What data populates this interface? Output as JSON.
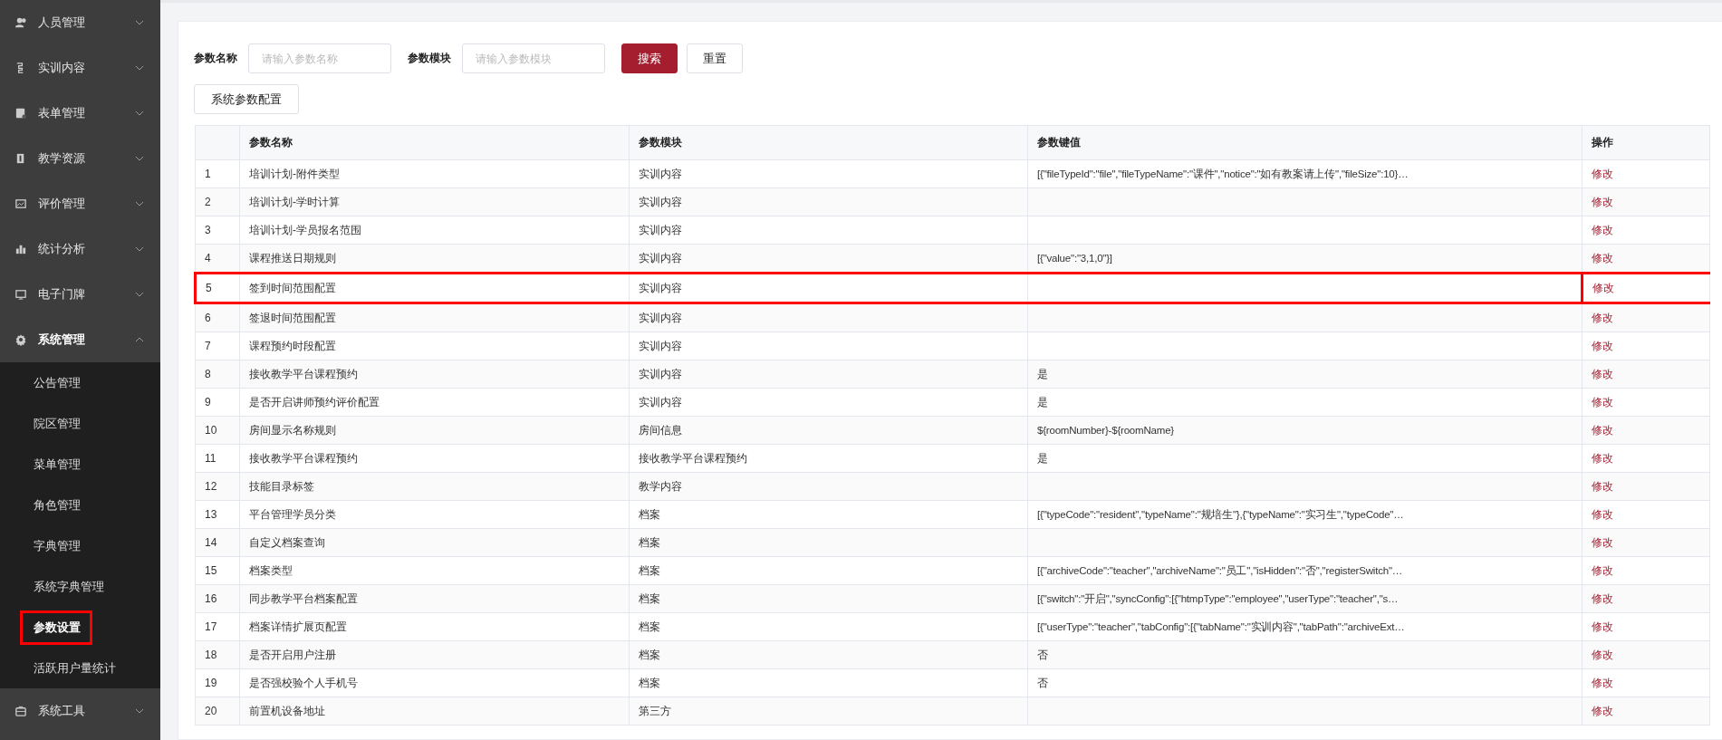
{
  "sidebar": {
    "items": [
      {
        "label": "人员管理",
        "expanded": false
      },
      {
        "label": "实训内容",
        "expanded": false
      },
      {
        "label": "表单管理",
        "expanded": false
      },
      {
        "label": "教学资源",
        "expanded": false
      },
      {
        "label": "评价管理",
        "expanded": false
      },
      {
        "label": "统计分析",
        "expanded": false
      },
      {
        "label": "电子门牌",
        "expanded": false
      },
      {
        "label": "系统管理",
        "expanded": true,
        "children": [
          {
            "label": "公告管理",
            "selected": false
          },
          {
            "label": "院区管理",
            "selected": false
          },
          {
            "label": "菜单管理",
            "selected": false
          },
          {
            "label": "角色管理",
            "selected": false
          },
          {
            "label": "字典管理",
            "selected": false
          },
          {
            "label": "系统字典管理",
            "selected": false
          },
          {
            "label": "参数设置",
            "selected": true
          },
          {
            "label": "活跃用户量统计",
            "selected": false
          }
        ]
      },
      {
        "label": "系统工具",
        "expanded": false
      }
    ]
  },
  "search": {
    "fields": [
      {
        "label": "参数名称",
        "placeholder": "请输入参数名称"
      },
      {
        "label": "参数模块",
        "placeholder": "请输入参数模块"
      }
    ],
    "buttons": [
      {
        "label": "搜索",
        "kind": "primary"
      },
      {
        "label": "重置",
        "kind": "default"
      }
    ]
  },
  "toolbar": {
    "buttons": [
      "系统参数配置"
    ]
  },
  "table": {
    "columns": [
      "参数名称",
      "参数模块",
      "参数键值",
      "操作"
    ],
    "rows": [
      {
        "index": "1",
        "name": "培训计划-附件类型",
        "module": "实训内容",
        "value": "[{\"fileTypeId\":\"file\",\"fileTypeName\":\"课件\",\"notice\":\"如有教案请上传\",\"fileSize\":10}…",
        "action": "修改",
        "highlighted": false
      },
      {
        "index": "2",
        "name": "培训计划-学时计算",
        "module": "实训内容",
        "value": "",
        "action": "修改",
        "highlighted": false
      },
      {
        "index": "3",
        "name": "培训计划-学员报名范围",
        "module": "实训内容",
        "value": "",
        "action": "修改",
        "highlighted": false
      },
      {
        "index": "4",
        "name": "课程推送日期规则",
        "module": "实训内容",
        "value": "[{\"value\":\"3,1,0\"}]",
        "action": "修改",
        "highlighted": false
      },
      {
        "index": "5",
        "name": "签到时间范围配置",
        "module": "实训内容",
        "value": "",
        "action": "修改",
        "highlighted": true
      },
      {
        "index": "6",
        "name": "签退时间范围配置",
        "module": "实训内容",
        "value": "",
        "action": "修改",
        "highlighted": false
      },
      {
        "index": "7",
        "name": "课程预约时段配置",
        "module": "实训内容",
        "value": "",
        "action": "修改",
        "highlighted": false
      },
      {
        "index": "8",
        "name": "接收教学平台课程预约",
        "module": "实训内容",
        "value": "是",
        "action": "修改",
        "highlighted": false
      },
      {
        "index": "9",
        "name": "是否开启讲师预约评价配置",
        "module": "实训内容",
        "value": "是",
        "action": "修改",
        "highlighted": false
      },
      {
        "index": "10",
        "name": "房间显示名称规则",
        "module": "房间信息",
        "value": "${roomNumber}-${roomName}",
        "action": "修改",
        "highlighted": false
      },
      {
        "index": "11",
        "name": "接收教学平台课程预约",
        "module": "接收教学平台课程预约",
        "value": "是",
        "action": "修改",
        "highlighted": false
      },
      {
        "index": "12",
        "name": "技能目录标签",
        "module": "教学内容",
        "value": "",
        "action": "修改",
        "highlighted": false
      },
      {
        "index": "13",
        "name": "平台管理学员分类",
        "module": "档案",
        "value": "[{\"typeCode\":\"resident\",\"typeName\":\"规培生\"},{\"typeName\":\"实习生\",\"typeCode\"…",
        "action": "修改",
        "highlighted": false
      },
      {
        "index": "14",
        "name": "自定义档案查询",
        "module": "档案",
        "value": "",
        "action": "修改",
        "highlighted": false
      },
      {
        "index": "15",
        "name": "档案类型",
        "module": "档案",
        "value": "[{\"archiveCode\":\"teacher\",\"archiveName\":\"员工\",\"isHidden\":\"否\",\"registerSwitch\"…",
        "action": "修改",
        "highlighted": false
      },
      {
        "index": "16",
        "name": "同步教学平台档案配置",
        "module": "档案",
        "value": "[{\"switch\":\"开启\",\"syncConfig\":[{\"htmpType\":\"employee\",\"userType\":\"teacher\",\"s…",
        "action": "修改",
        "highlighted": false
      },
      {
        "index": "17",
        "name": "档案详情扩展页配置",
        "module": "档案",
        "value": "[{\"userType\":\"teacher\",\"tabConfig\":[{\"tabName\":\"实训内容\",\"tabPath\":\"archiveExt…",
        "action": "修改",
        "highlighted": false
      },
      {
        "index": "18",
        "name": "是否开启用户注册",
        "module": "档案",
        "value": "否",
        "action": "修改",
        "highlighted": false
      },
      {
        "index": "19",
        "name": "是否强校验个人手机号",
        "module": "档案",
        "value": "否",
        "action": "修改",
        "highlighted": false
      },
      {
        "index": "20",
        "name": "前置机设备地址",
        "module": "第三方",
        "value": "",
        "action": "修改",
        "highlighted": false
      }
    ]
  }
}
